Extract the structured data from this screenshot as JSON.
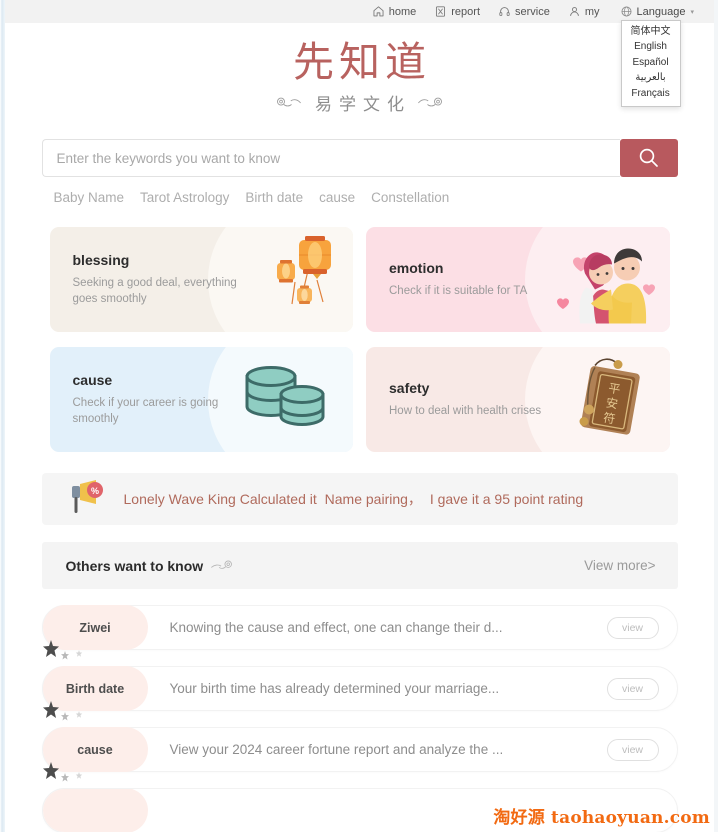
{
  "topnav": {
    "items": [
      {
        "label": "home",
        "icon": "home-icon"
      },
      {
        "label": "report",
        "icon": "report-icon"
      },
      {
        "label": "service",
        "icon": "headset-icon"
      },
      {
        "label": "my",
        "icon": "user-icon"
      }
    ],
    "language": {
      "label": "Language",
      "icon": "globe-icon",
      "caret": "▾",
      "options": [
        "简体中文",
        "English",
        "Español",
        "بالعربية",
        "Français"
      ]
    }
  },
  "logo": {
    "main": "先知道",
    "sub": "易学文化"
  },
  "search": {
    "placeholder": "Enter the keywords you want to know",
    "value": "",
    "button_icon": "search-icon",
    "tags": [
      "Baby Name",
      "Tarot Astrology",
      "Birth date",
      "cause",
      "Constellation"
    ]
  },
  "cards": [
    {
      "title": "blessing",
      "desc": "Seeking a good deal, everything goes smoothly",
      "art": "lantern-illustration",
      "bg": "#f4efe8"
    },
    {
      "title": "emotion",
      "desc": "Check if it is suitable for TA",
      "art": "couple-illustration",
      "bg": "#fcdfe5"
    },
    {
      "title": "cause",
      "desc": "Check if your career is going smoothly",
      "art": "coins-illustration",
      "bg": "#e2f0fa"
    },
    {
      "title": "safety",
      "desc": "How to deal with health crises",
      "art": "amulet-illustration",
      "bg": "#f8e9e6"
    }
  ],
  "notice": {
    "icon": "megaphone-icon",
    "badge": "%",
    "part1": "Lonely Wave King Calculated it",
    "part2": "Name pairing，",
    "part3": "I gave it a 95 point rating",
    "color": "#b06a5c"
  },
  "section": {
    "title": "Others want to know",
    "decor": "cloud-icon",
    "more": "View more>"
  },
  "list": {
    "rows": [
      {
        "tag": "Ziwei",
        "text": "Knowing the cause and effect, one can change their d...",
        "button": "view"
      },
      {
        "tag": "Birth date",
        "text": "Your birth time has already determined your marriage...",
        "button": "view"
      },
      {
        "tag": "cause",
        "text": "View your 2024 career fortune report and analyze the ...",
        "button": "view"
      }
    ]
  },
  "watermark": "淘好源 taohaoyuan.com"
}
